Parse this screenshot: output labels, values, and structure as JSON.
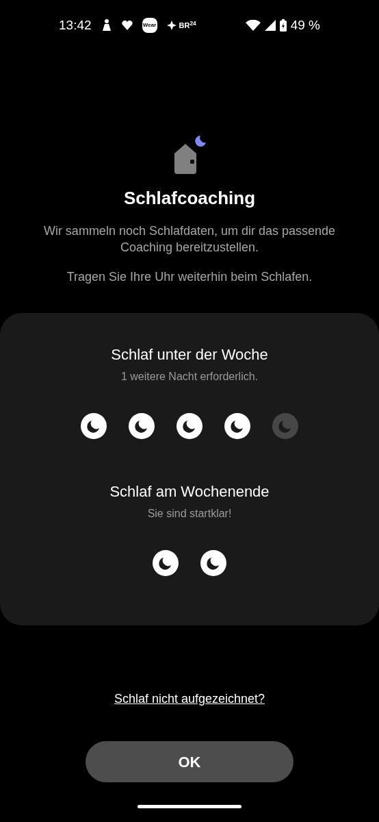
{
  "status_bar": {
    "time": "13:42",
    "app_badges": [
      "Wear",
      "BR$^{24}$"
    ],
    "battery": "49 %"
  },
  "title": "Schlafcoaching",
  "messages": [
    "Wir sammeln noch Schlafdaten, um dir das passende Coaching bereitzustellen.",
    "Tragen Sie Ihre Uhr weiterhin beim Schlafen."
  ],
  "sections": [
    {
      "title": "Schlaf unter der Woche",
      "subtitle": "1 weitere Nacht erforderlich.",
      "nights": [
        {
          "recorded": true
        },
        {
          "recorded": true
        },
        {
          "recorded": true
        },
        {
          "recorded": true
        },
        {
          "recorded": false
        }
      ]
    },
    {
      "title": "Schlaf am Wochenende",
      "subtitle": "Sie sind startklar!",
      "nights": [
        {
          "recorded": true
        },
        {
          "recorded": true
        }
      ]
    }
  ],
  "link": "Schlaf nicht aufgezeichnet?",
  "button": "OK"
}
